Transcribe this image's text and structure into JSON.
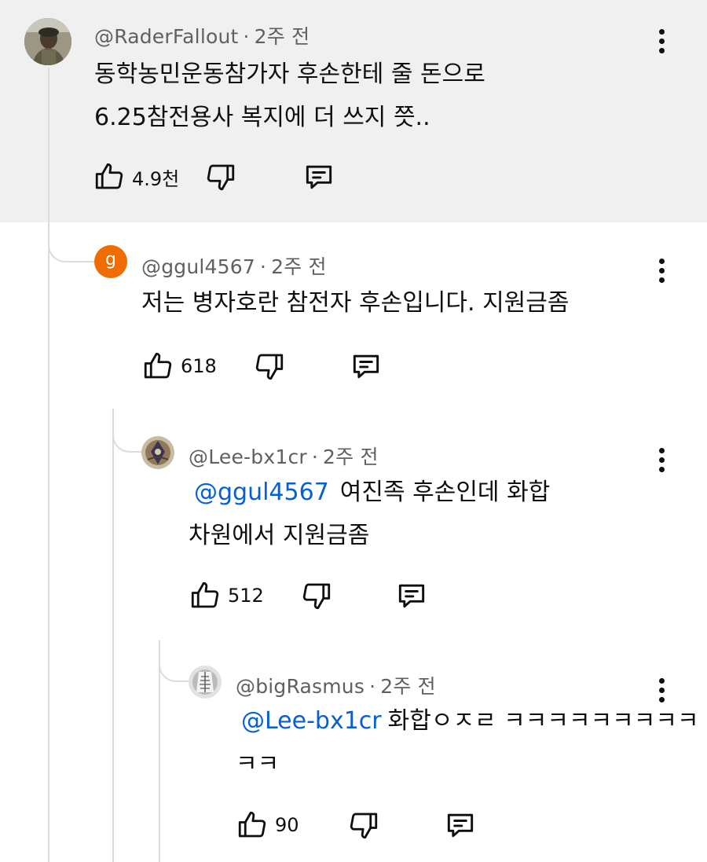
{
  "comments": [
    {
      "handle": "@RaderFallout",
      "time": "2주 전",
      "lines": [
        "동학농민운동참가자 후손한테 줄 돈으로",
        "6.25참전용사 복지에 더 쓰지 쯧.."
      ],
      "likes": "4.9천"
    },
    {
      "handle": "@ggul4567",
      "time": "2주 전",
      "avatar_letter": "g",
      "lines": [
        "저는 병자호란 참전자 후손입니다. 지원금좀"
      ],
      "likes": "618"
    },
    {
      "handle": "@Lee-bx1cr",
      "time": "2주 전",
      "mention": "@ggul4567",
      "line1_rest": "여진족 후손인데 화합",
      "line2": "차원에서 지원금좀",
      "likes": "512"
    },
    {
      "handle": "@bigRasmus",
      "time": "2주 전",
      "mention": "@Lee-bx1cr",
      "line1_rest": "화합ㅇㅈㄹ ㅋㅋㅋㅋㅋㅋㅋㅋㅋ",
      "line2": "ㅋㅋ",
      "likes": "90"
    }
  ],
  "separator": "·",
  "colors": {
    "highlight_bg": "#f0f0f0",
    "mention": "#065fd4",
    "meta": "#606060",
    "orange_avatar": "#ef6c00"
  },
  "icons": {
    "like": "thumbs-up-icon",
    "dislike": "thumbs-down-icon",
    "reply": "reply-comment-icon",
    "more": "more-vertical-icon"
  }
}
